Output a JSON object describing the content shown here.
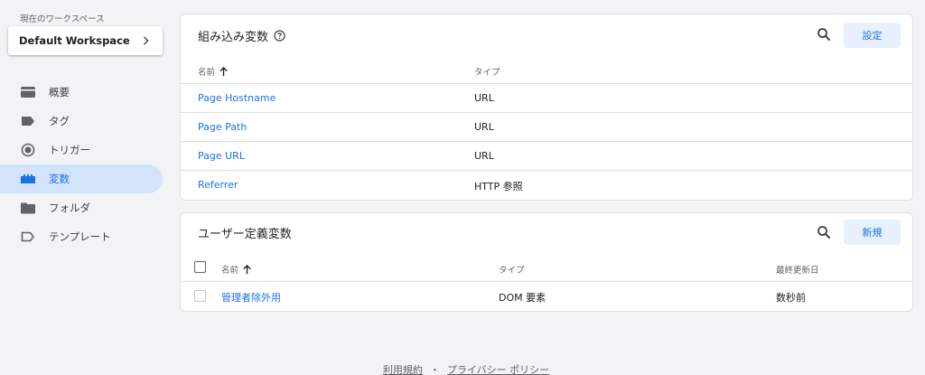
{
  "workspace": {
    "caption": "現在のワークスペース",
    "name": "Default Workspace"
  },
  "nav": [
    {
      "label": "概要",
      "icon": "overview-icon",
      "active": false
    },
    {
      "label": "タグ",
      "icon": "tag-icon",
      "active": false
    },
    {
      "label": "トリガー",
      "icon": "trigger-icon",
      "active": false
    },
    {
      "label": "変数",
      "icon": "variables-icon",
      "active": true
    },
    {
      "label": "フォルダ",
      "icon": "folder-icon",
      "active": false
    },
    {
      "label": "テンプレート",
      "icon": "template-icon",
      "active": false
    }
  ],
  "builtin": {
    "title": "組み込み変数",
    "button": "設定",
    "columns": {
      "name": "名前",
      "type": "タイプ"
    },
    "rows": [
      {
        "name": "Page Hostname",
        "type": "URL"
      },
      {
        "name": "Page Path",
        "type": "URL"
      },
      {
        "name": "Page URL",
        "type": "URL"
      },
      {
        "name": "Referrer",
        "type": "HTTP 参照"
      }
    ]
  },
  "user_defined": {
    "title": "ユーザー定義変数",
    "button": "新規",
    "columns": {
      "name": "名前",
      "type": "タイプ",
      "updated": "最終更新日"
    },
    "rows": [
      {
        "name": "管理者除外用",
        "type": "DOM 要素",
        "updated": "数秒前"
      }
    ]
  },
  "footer": {
    "terms": "利用規約",
    "separator": "・",
    "privacy": "プライバシー ポリシー"
  },
  "colors": {
    "accent": "#1a73e8",
    "active_nav_bg": "#d2e3fc",
    "button_bg": "#e8f0fe",
    "page_bg": "#f1f3f4"
  }
}
